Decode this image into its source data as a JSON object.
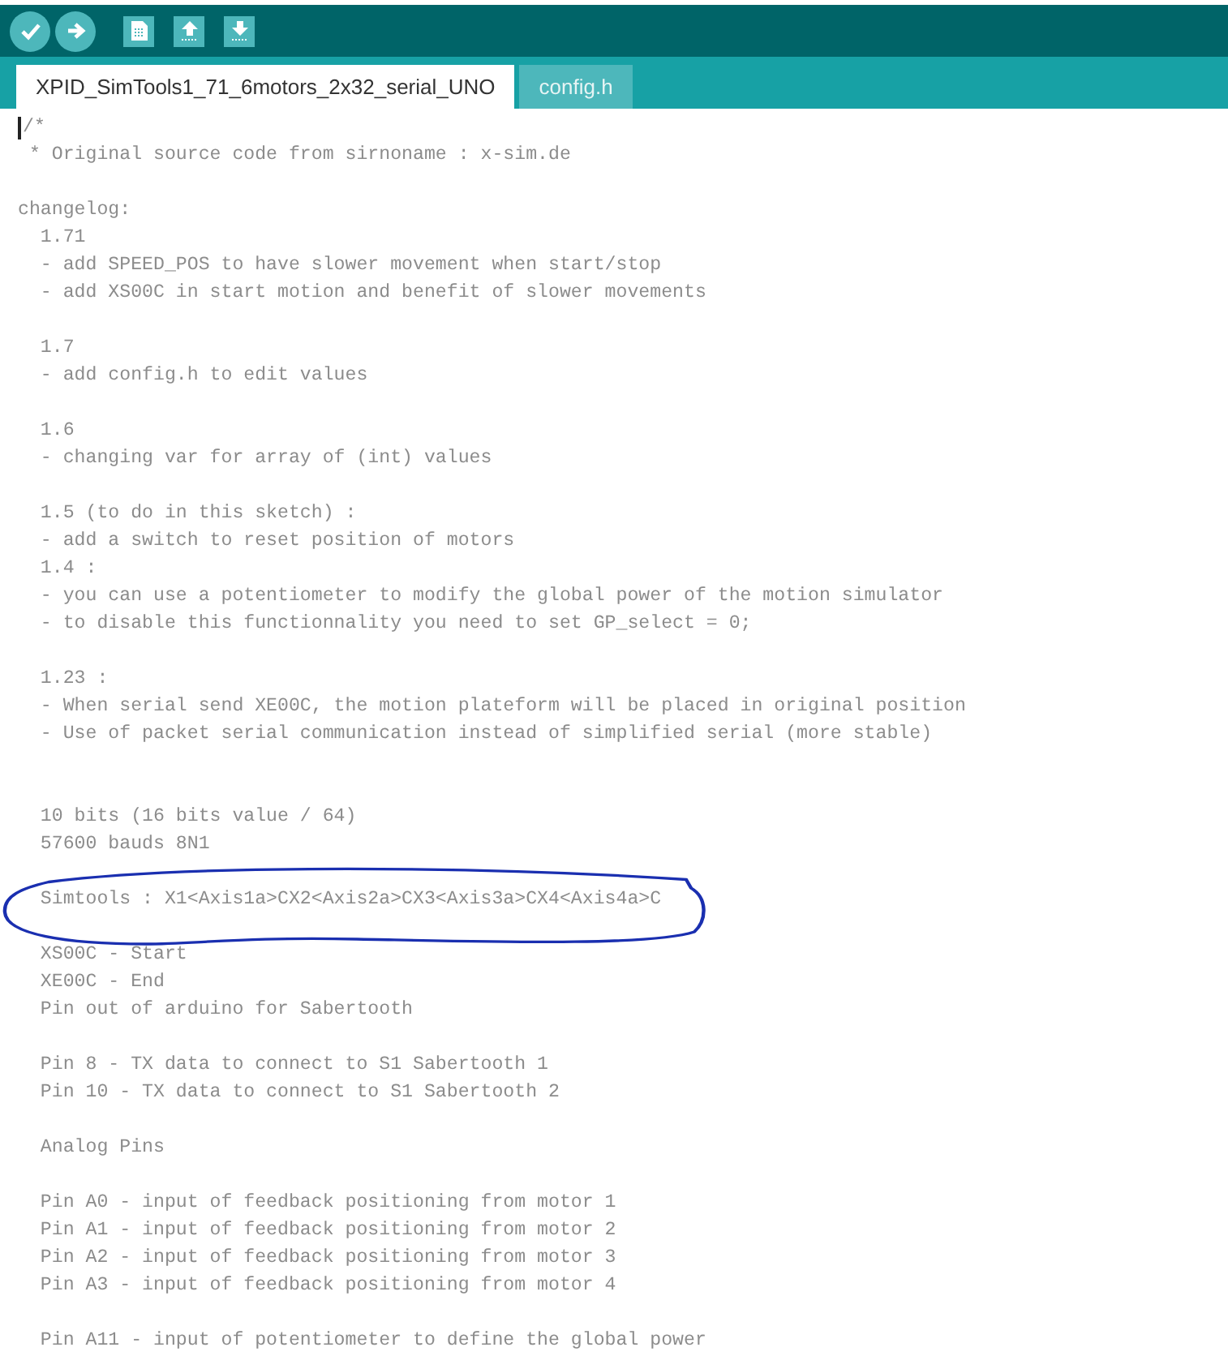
{
  "tabs": [
    {
      "label": "XPID_SimTools1_71_6motors_2x32_serial_UNO",
      "selected": true
    },
    {
      "label": "config.h",
      "selected": false
    }
  ],
  "editor": {
    "cursor": true,
    "annotation": {
      "kind": "freehand-loop"
    },
    "lines": [
      {
        "kind": "text",
        "text": "/*"
      },
      {
        "kind": "text",
        "text": " * Original source code from sirnoname : x-sim.de"
      },
      {
        "kind": "blank"
      },
      {
        "kind": "text",
        "text": "changelog:"
      },
      {
        "kind": "text",
        "text": "  1.71"
      },
      {
        "kind": "text",
        "text": "  - add SPEED_POS to have slower movement when start/stop"
      },
      {
        "kind": "text",
        "text": "  - add XS00C in start motion and benefit of slower movements"
      },
      {
        "kind": "blank"
      },
      {
        "kind": "text",
        "text": "  1.7"
      },
      {
        "kind": "text",
        "text": "  - add config.h to edit values"
      },
      {
        "kind": "blank"
      },
      {
        "kind": "text",
        "text": "  1.6"
      },
      {
        "kind": "text",
        "text": "  - changing var for array of (int) values"
      },
      {
        "kind": "blank"
      },
      {
        "kind": "text",
        "text": "  1.5 (to do in this sketch) :"
      },
      {
        "kind": "text",
        "text": "  - add a switch to reset position of motors"
      },
      {
        "kind": "text",
        "text": "  1.4 :"
      },
      {
        "kind": "text",
        "text": "  - you can use a potentiometer to modify the global power of the motion simulator"
      },
      {
        "kind": "text",
        "text": "  - to disable this functionnality you need to set GP_select = 0;"
      },
      {
        "kind": "blank"
      },
      {
        "kind": "text",
        "text": "  1.23 :"
      },
      {
        "kind": "text",
        "text": "  - When serial send XE00C, the motion plateform will be placed in original position"
      },
      {
        "kind": "text",
        "text": "  - Use of packet serial communication instead of simplified serial (more stable)"
      },
      {
        "kind": "blank"
      },
      {
        "kind": "blank"
      },
      {
        "kind": "text",
        "text": "  10 bits (16 bits value / 64)"
      },
      {
        "kind": "text",
        "text": "  57600 bauds 8N1"
      },
      {
        "kind": "blank"
      },
      {
        "kind": "text",
        "text": "  Simtools : X1<Axis1a>CX2<Axis2a>CX3<Axis3a>CX4<Axis4a>C"
      },
      {
        "kind": "blank"
      },
      {
        "kind": "text",
        "text": "  XS00C - Start"
      },
      {
        "kind": "text",
        "text": "  XE00C - End"
      },
      {
        "kind": "text",
        "text": "  Pin out of arduino for Sabertooth"
      },
      {
        "kind": "blank"
      },
      {
        "kind": "text",
        "text": "  Pin 8 - TX data to connect to S1 Sabertooth 1"
      },
      {
        "kind": "text",
        "text": "  Pin 10 - TX data to connect to S1 Sabertooth 2"
      },
      {
        "kind": "blank"
      },
      {
        "kind": "text",
        "text": "  Analog Pins"
      },
      {
        "kind": "blank"
      },
      {
        "kind": "text",
        "text": "  Pin A0 - input of feedback positioning from motor 1"
      },
      {
        "kind": "text",
        "text": "  Pin A1 - input of feedback positioning from motor 2"
      },
      {
        "kind": "text",
        "text": "  Pin A2 - input of feedback positioning from motor 3"
      },
      {
        "kind": "text",
        "text": "  Pin A3 - input of feedback positioning from motor 4"
      },
      {
        "kind": "blank"
      },
      {
        "kind": "text",
        "text": "  Pin A11 - input of potentiometer to define the global power"
      }
    ]
  }
}
